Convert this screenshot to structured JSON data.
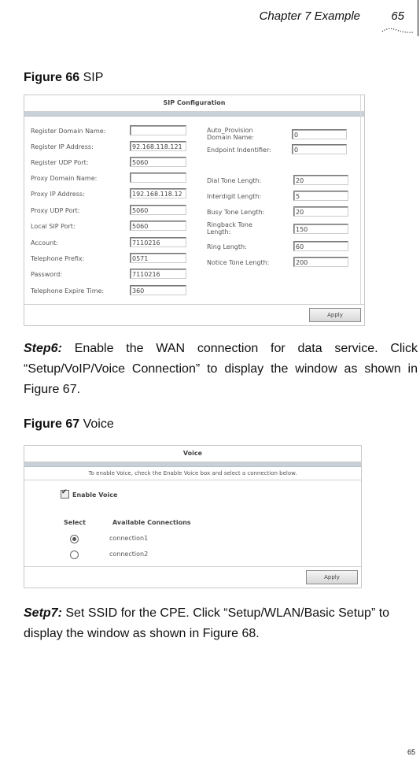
{
  "header": {
    "chapter": "Chapter 7 Example",
    "page_number": "65"
  },
  "figure66": {
    "label": "Figure 66",
    "title": "SIP",
    "panel": {
      "title": "SIP Configuration",
      "left_fields": [
        {
          "label": "Register Domain Name:",
          "value": ""
        },
        {
          "label": "Register IP Address:",
          "value": "92.168.118.121"
        },
        {
          "label": "Register UDP Port:",
          "value": "5060"
        },
        {
          "label": "Proxy Domain Name:",
          "value": ""
        },
        {
          "label": "Proxy IP Address:",
          "value": "192.168.118.12"
        },
        {
          "label": "Proxy UDP Port:",
          "value": "5060"
        },
        {
          "label": "Local SIP Port:",
          "value": "5060"
        },
        {
          "label": "Account:",
          "value": "7110216"
        },
        {
          "label": "Telephone Prefix:",
          "value": "0571"
        },
        {
          "label": "Password:",
          "value": "7110216"
        },
        {
          "label": "Telephone Expire Time:",
          "value": "360"
        }
      ],
      "right_top_fields": [
        {
          "label": "Auto_Provision Domain Name:",
          "value": "0"
        },
        {
          "label": "Endpoint Indentifier:",
          "value": "0"
        }
      ],
      "right_bottom_fields": [
        {
          "label": "Dial Tone Length:",
          "value": "20"
        },
        {
          "label": "Interdigit Length:",
          "value": "5"
        },
        {
          "label": "Busy Tone Length:",
          "value": "20"
        },
        {
          "label": "Ringback Tone Length:",
          "value": "150"
        },
        {
          "label": "Ring Length:",
          "value": "60"
        },
        {
          "label": "Notice Tone Length:",
          "value": "200"
        }
      ],
      "apply_label": "Apply"
    }
  },
  "step6": {
    "label": "Step6:",
    "text": " Enable the WAN connection for data service. Click “Setup/VoIP/Voice Connection” to display the window as shown in Figure 67."
  },
  "figure67": {
    "label": "Figure 67",
    "title": "Voice",
    "panel": {
      "title": "Voice",
      "description": "To enable Voice, check the Enable Voice box and select a connection below.",
      "enable_voice_label": "Enable Voice",
      "enable_voice_checked": true,
      "select_header": "Select",
      "connections_header": "Available Connections",
      "connections": [
        {
          "name": "connection1",
          "selected": true
        },
        {
          "name": "connection2",
          "selected": false
        }
      ],
      "apply_label": "Apply"
    }
  },
  "step7": {
    "label": "Setp7:",
    "text": " Set SSID for the CPE. Click “Setup/WLAN/Basic Setup” to display the window as shown in Figure 68."
  },
  "footer": {
    "page_number": "65"
  }
}
